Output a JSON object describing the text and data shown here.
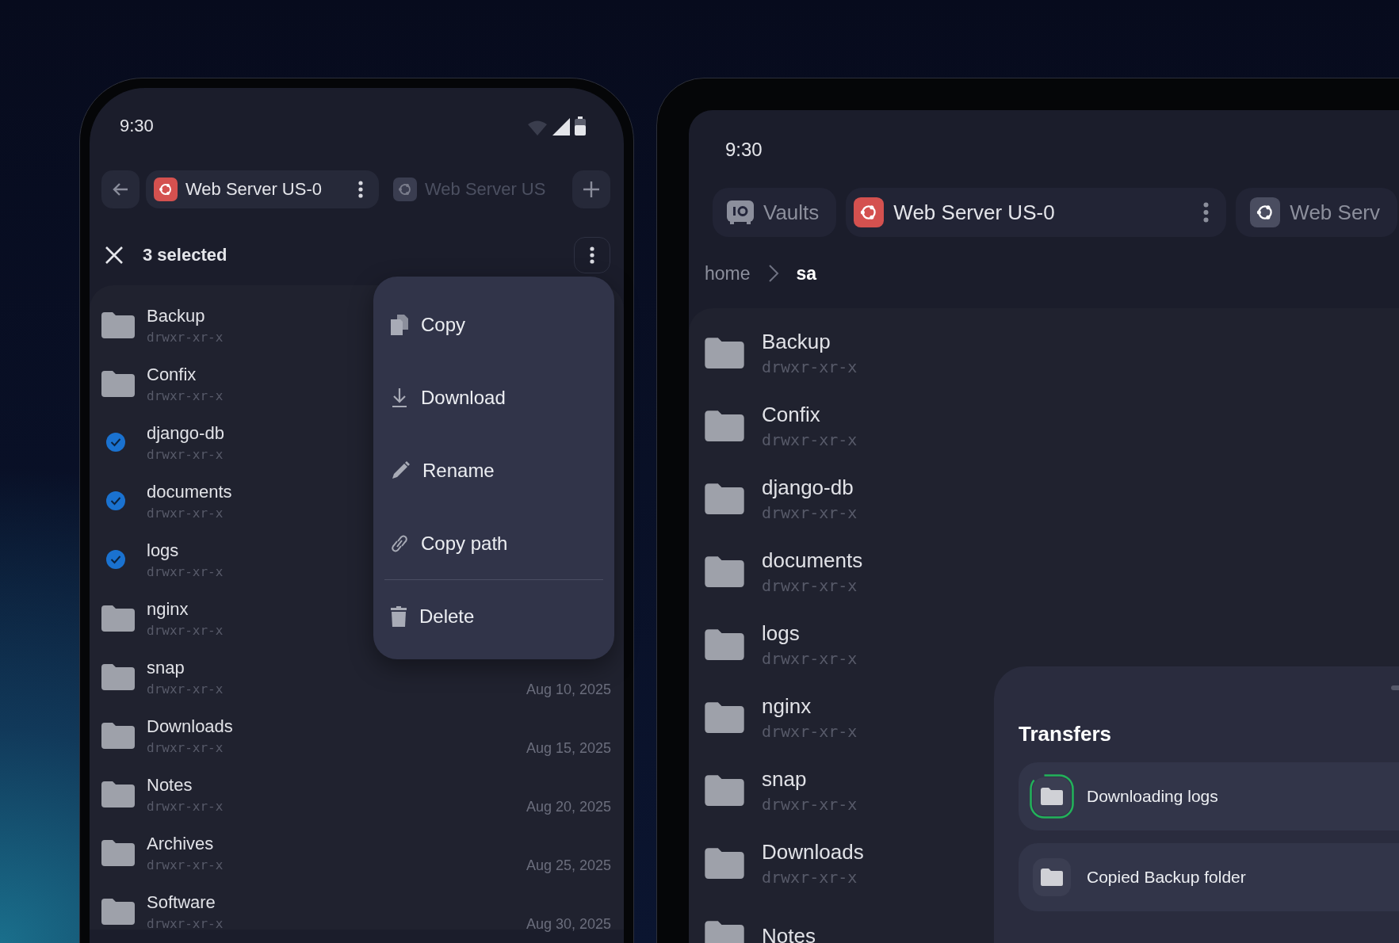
{
  "phone": {
    "status_bar": {
      "time": "9:30"
    },
    "tabs": [
      {
        "label": "Web Server US-0",
        "selected": true
      },
      {
        "label": "Web Server US",
        "selected": false
      }
    ],
    "selection_bar": {
      "count": "3 selected"
    },
    "files": [
      {
        "name": "Backup",
        "permissions": "drwxr-xr-x",
        "checked": false
      },
      {
        "name": "Confix",
        "permissions": "drwxr-xr-x",
        "checked": false
      },
      {
        "name": "django-db",
        "permissions": "drwxr-xr-x",
        "checked": true
      },
      {
        "name": "documents",
        "permissions": "drwxr-xr-x",
        "checked": true
      },
      {
        "name": "logs",
        "permissions": "drwxr-xr-x",
        "checked": true
      },
      {
        "name": "nginx",
        "permissions": "drwxr-xr-x",
        "checked": false
      },
      {
        "name": "snap",
        "permissions": "drwxr-xr-x",
        "date": "Aug 10, 2025",
        "checked": false
      },
      {
        "name": "Downloads",
        "permissions": "drwxr-xr-x",
        "date": "Aug 15, 2025",
        "checked": false
      },
      {
        "name": "Notes",
        "permissions": "drwxr-xr-x",
        "date": "Aug 20, 2025",
        "checked": false
      },
      {
        "name": "Archives",
        "permissions": "drwxr-xr-x",
        "date": "Aug 25, 2025",
        "checked": false
      },
      {
        "name": "Software",
        "permissions": "drwxr-xr-x",
        "date": "Aug 30, 2025",
        "checked": false
      }
    ],
    "context_menu": {
      "groups": [
        [
          {
            "label": "Copy",
            "kind": "copy"
          },
          {
            "label": "Download",
            "kind": "download"
          },
          {
            "label": "Rename",
            "kind": "rename"
          },
          {
            "label": "Copy path",
            "kind": "link"
          }
        ],
        [
          {
            "label": "Delete",
            "kind": "delete"
          }
        ]
      ]
    }
  },
  "tablet": {
    "status_bar": {
      "time": "9:30"
    },
    "tabs": [
      {
        "label": "Vaults",
        "kind": "vaults",
        "selected": false
      },
      {
        "label": "Web Server US-0",
        "kind": "server",
        "selected": true
      },
      {
        "label": "Web Serv",
        "kind": "server",
        "selected": false
      }
    ],
    "breadcrumb": [
      "home",
      "sa"
    ],
    "files": [
      {
        "name": "Backup",
        "permissions": "drwxr-xr-x"
      },
      {
        "name": "Confix",
        "permissions": "drwxr-xr-x"
      },
      {
        "name": "django-db",
        "permissions": "drwxr-xr-x"
      },
      {
        "name": "documents",
        "permissions": "drwxr-xr-x"
      },
      {
        "name": "logs",
        "permissions": "drwxr-xr-x"
      },
      {
        "name": "nginx",
        "permissions": "drwxr-xr-x"
      },
      {
        "name": "snap",
        "permissions": "drwxr-xr-x"
      },
      {
        "name": "Downloads",
        "permissions": "drwxr-xr-x"
      },
      {
        "name": "Notes"
      }
    ],
    "transfers": {
      "title": "Transfers",
      "items": [
        {
          "label": "Downloading logs",
          "in_progress": true
        },
        {
          "label": "Copied Backup folder",
          "in_progress": false
        }
      ]
    }
  }
}
